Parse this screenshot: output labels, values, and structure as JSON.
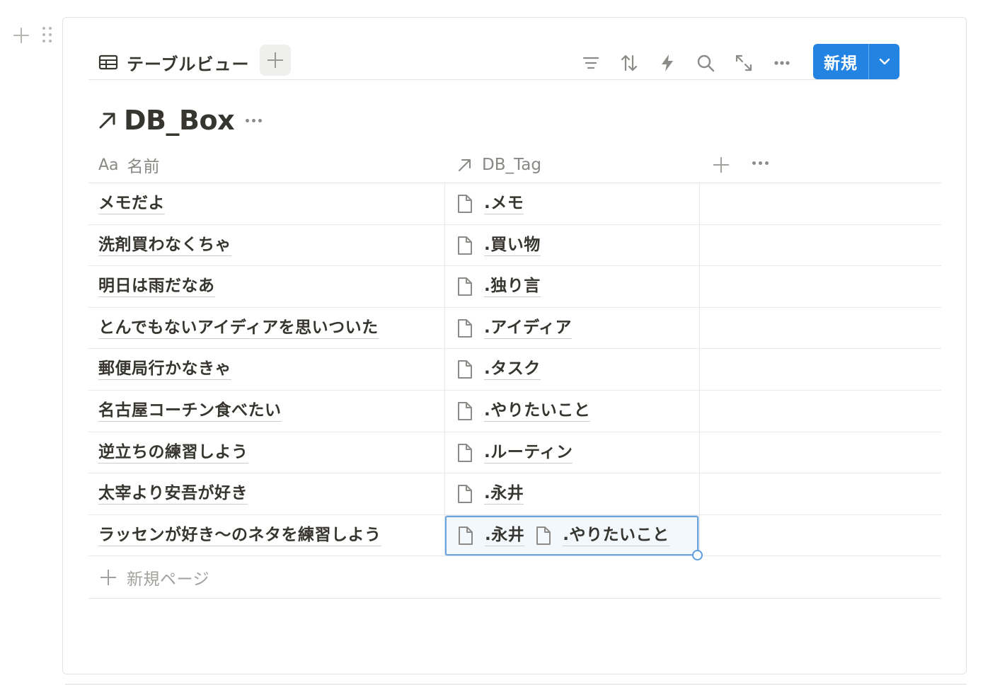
{
  "view": {
    "tab_label": "テーブルビュー"
  },
  "toolbar": {
    "icons": [
      "filter-icon",
      "sort-icon",
      "automation-icon",
      "search-icon",
      "expand-icon",
      "more-icon"
    ],
    "new_label": "新規"
  },
  "database": {
    "title": "DB_Box"
  },
  "columns": {
    "name": "名前",
    "name_prefix": "Aa",
    "tag": "DB_Tag"
  },
  "rows": [
    {
      "name": "メモだよ",
      "tags": [
        ".メモ"
      ]
    },
    {
      "name": "洗剤買わなくちゃ",
      "tags": [
        ".買い物"
      ]
    },
    {
      "name": "明日は雨だなあ",
      "tags": [
        ".独り言"
      ]
    },
    {
      "name": "とんでもないアイディアを思いついた",
      "tags": [
        ".アイディア"
      ]
    },
    {
      "name": "郵便局行かなきゃ",
      "tags": [
        ".タスク"
      ]
    },
    {
      "name": "名古屋コーチン食べたい",
      "tags": [
        ".やりたいこと"
      ]
    },
    {
      "name": "逆立ちの練習しよう",
      "tags": [
        ".ルーティン"
      ]
    },
    {
      "name": "太宰より安吾が好き",
      "tags": [
        ".永井"
      ]
    },
    {
      "name": "ラッセンが好き〜のネタを練習しよう",
      "tags": [
        ".永井",
        ".やりたいこと"
      ]
    }
  ],
  "new_page_label": "新規ページ",
  "colors": {
    "accent": "#2383e2",
    "selection_border": "#6fa4dd",
    "text": "#37352f",
    "muted": "#8a8884"
  }
}
